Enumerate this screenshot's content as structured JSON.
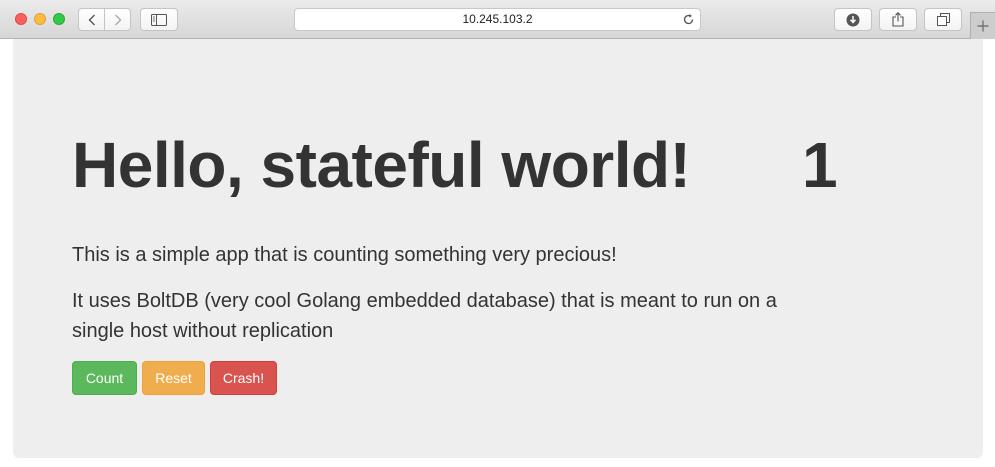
{
  "browser": {
    "url": "10.245.103.2",
    "icons": {
      "back": "chevron-left-icon",
      "forward": "chevron-right-icon",
      "sidebar": "sidebar-icon",
      "reload": "reload-icon",
      "downloads": "download-icon",
      "share": "share-icon",
      "tabs": "tabs-icon",
      "new_tab": "plus-icon"
    }
  },
  "page": {
    "heading": "Hello, stateful world!",
    "counter": "1",
    "paragraph1": "This is a simple app that is counting something very precious!",
    "paragraph2": "It uses BoltDB (very cool Golang embedded database) that is meant to run on a single host without replication",
    "buttons": {
      "count": "Count",
      "reset": "Reset",
      "crash": "Crash!"
    }
  },
  "colors": {
    "jumbotron_bg": "#eeeeee",
    "text": "#333333",
    "success": "#5cb85c",
    "warning": "#f0ad4e",
    "danger": "#d9534f"
  }
}
